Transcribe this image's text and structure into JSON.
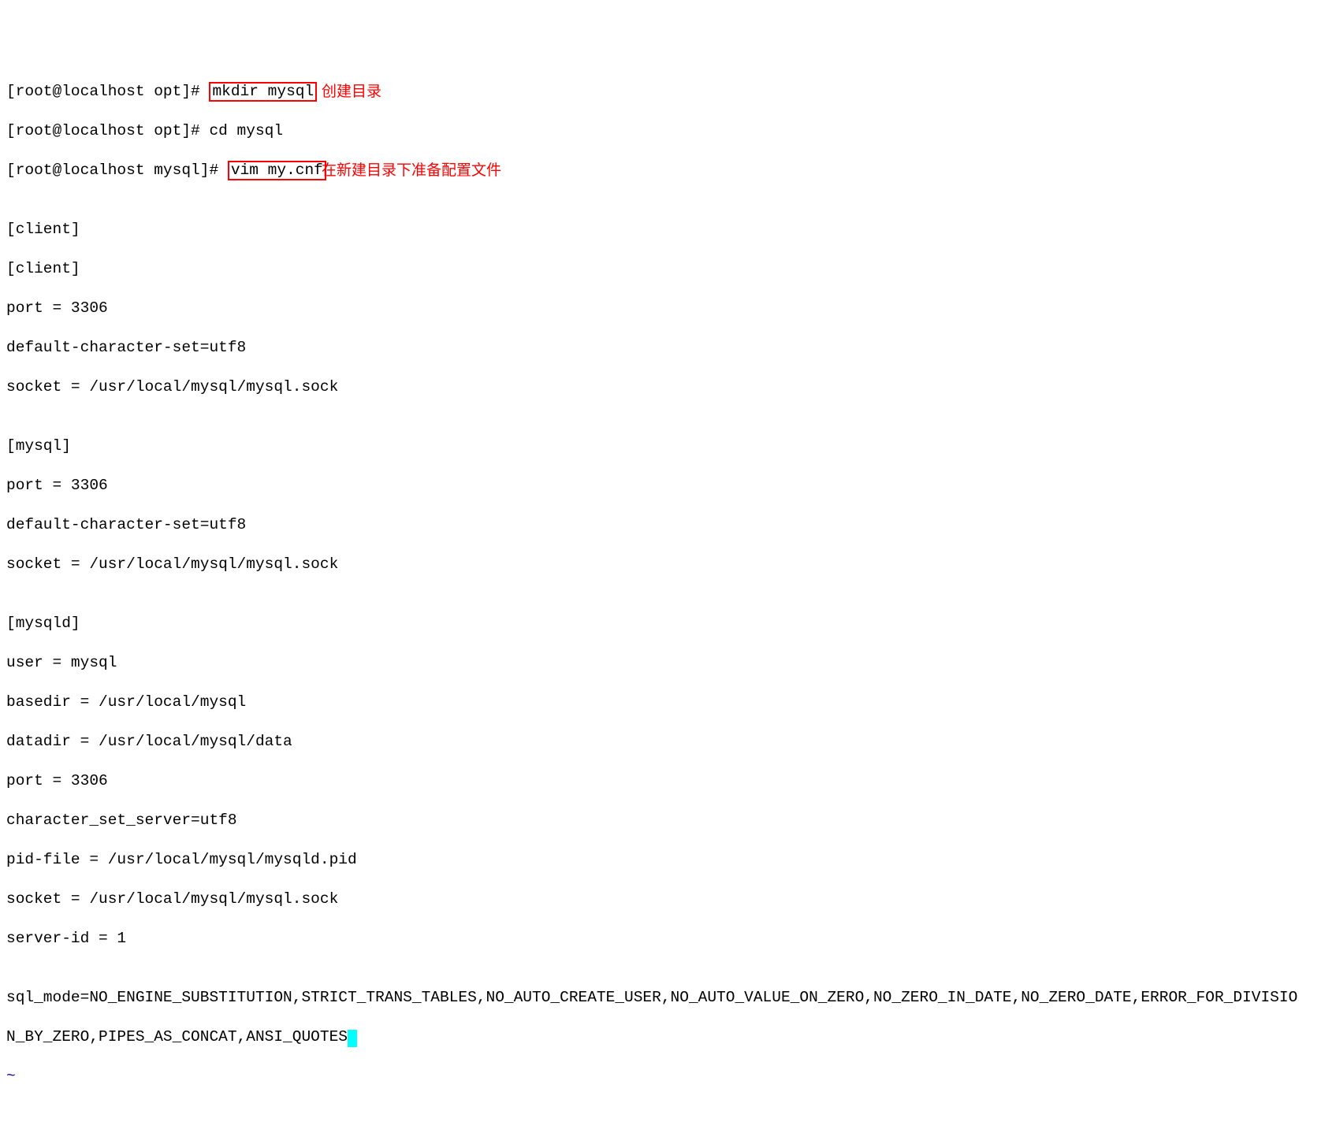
{
  "terminal": {
    "lines": {
      "l1_prefix": "[root@localhost opt]# ",
      "l1_cmd": "mkdir mysql",
      "l1_annot": "创建目录",
      "l2": "[root@localhost opt]# cd mysql",
      "l3_prefix": "[root@localhost mysql]# ",
      "l3_cmd": "vim my.cnf",
      "l3_annot": "在新建目录下准备配置文件",
      "blank": "",
      "l5": "[client]",
      "l6": "[client]",
      "l7": "port = 3306",
      "l8": "default-character-set=utf8",
      "l9": "socket = /usr/local/mysql/mysql.sock",
      "l11": "[mysql]",
      "l12": "port = 3306",
      "l13": "default-character-set=utf8",
      "l14": "socket = /usr/local/mysql/mysql.sock",
      "l16": "[mysqld]",
      "l17": "user = mysql",
      "l18": "basedir = /usr/local/mysql",
      "l19": "datadir = /usr/local/mysql/data",
      "l20": "port = 3306",
      "l21": "character_set_server=utf8",
      "l22": "pid-file = /usr/local/mysql/mysqld.pid",
      "l23": "socket = /usr/local/mysql/mysql.sock",
      "l24": "server-id = 1",
      "l26": "sql_mode=NO_ENGINE_SUBSTITUTION,STRICT_TRANS_TABLES,NO_AUTO_CREATE_USER,NO_AUTO_VALUE_ON_ZERO,NO_ZERO_IN_DATE,NO_ZERO_DATE,ERROR_FOR_DIVISIO",
      "l27": "N_BY_ZERO,PIPES_AS_CONCAT,ANSI_QUOTES",
      "tilde": "~"
    }
  }
}
